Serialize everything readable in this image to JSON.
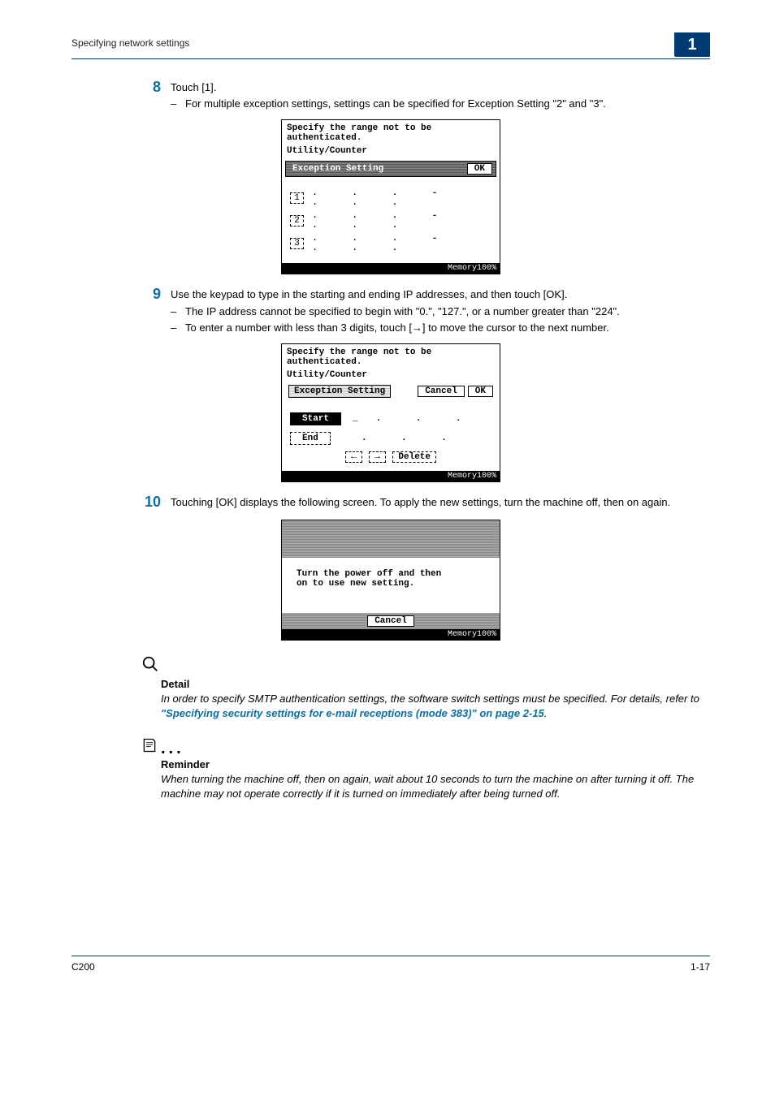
{
  "header": {
    "running_title": "Specifying network settings",
    "chapter": "1"
  },
  "step8": {
    "num": "8",
    "text": "Touch [1].",
    "bullet": "For multiple exception settings, settings can be specified for Exception Setting \"2\" and \"3\"."
  },
  "lcd1": {
    "line1": "Specify the range not to be",
    "line2": "authenticated.",
    "line3": "Utility/Counter",
    "title": "Exception Setting",
    "ok": "OK",
    "rows": [
      "1",
      "2",
      "3"
    ],
    "memory": "Memory100%"
  },
  "step9": {
    "num": "9",
    "text": "Use the keypad to type in the starting and ending IP addresses, and then touch [OK].",
    "b1": "The IP address cannot be specified to begin with \"0.\", \"127.\", or a number greater than \"224\".",
    "b2": "To enter a number with less than 3 digits, touch [→] to move the cursor to the next number."
  },
  "lcd2": {
    "line1": "Specify the range not to be",
    "line2": "authenticated.",
    "line3": "Utility/Counter",
    "title": "Exception Setting",
    "cancel": "Cancel",
    "ok": "OK",
    "start": "Start",
    "end": "End",
    "left": "←",
    "right": "→",
    "delete": "Delete",
    "memory": "Memory100%"
  },
  "step10": {
    "num": "10",
    "text": "Touching [OK] displays the following screen. To apply the new settings, turn the machine off, then on again."
  },
  "lcd3": {
    "msg1": "Turn the power off and then",
    "msg2": "on to use new setting.",
    "cancel": "Cancel",
    "memory": "Memory100%"
  },
  "detail": {
    "title": "Detail",
    "body_pre": "In order to specify SMTP authentication settings, the software switch settings must be specified. For details, refer to ",
    "link": "\"Specifying security settings for e-mail receptions (mode 383)\" on page 2-15",
    "body_post": "."
  },
  "reminder": {
    "dots": ". . .",
    "title": "Reminder",
    "body": "When turning the machine off, then on again, wait about 10 seconds to turn the machine on after turning it off. The machine may not operate correctly if it is turned on immediately after being turned off."
  },
  "footer": {
    "left": "C200",
    "right": "1-17"
  }
}
